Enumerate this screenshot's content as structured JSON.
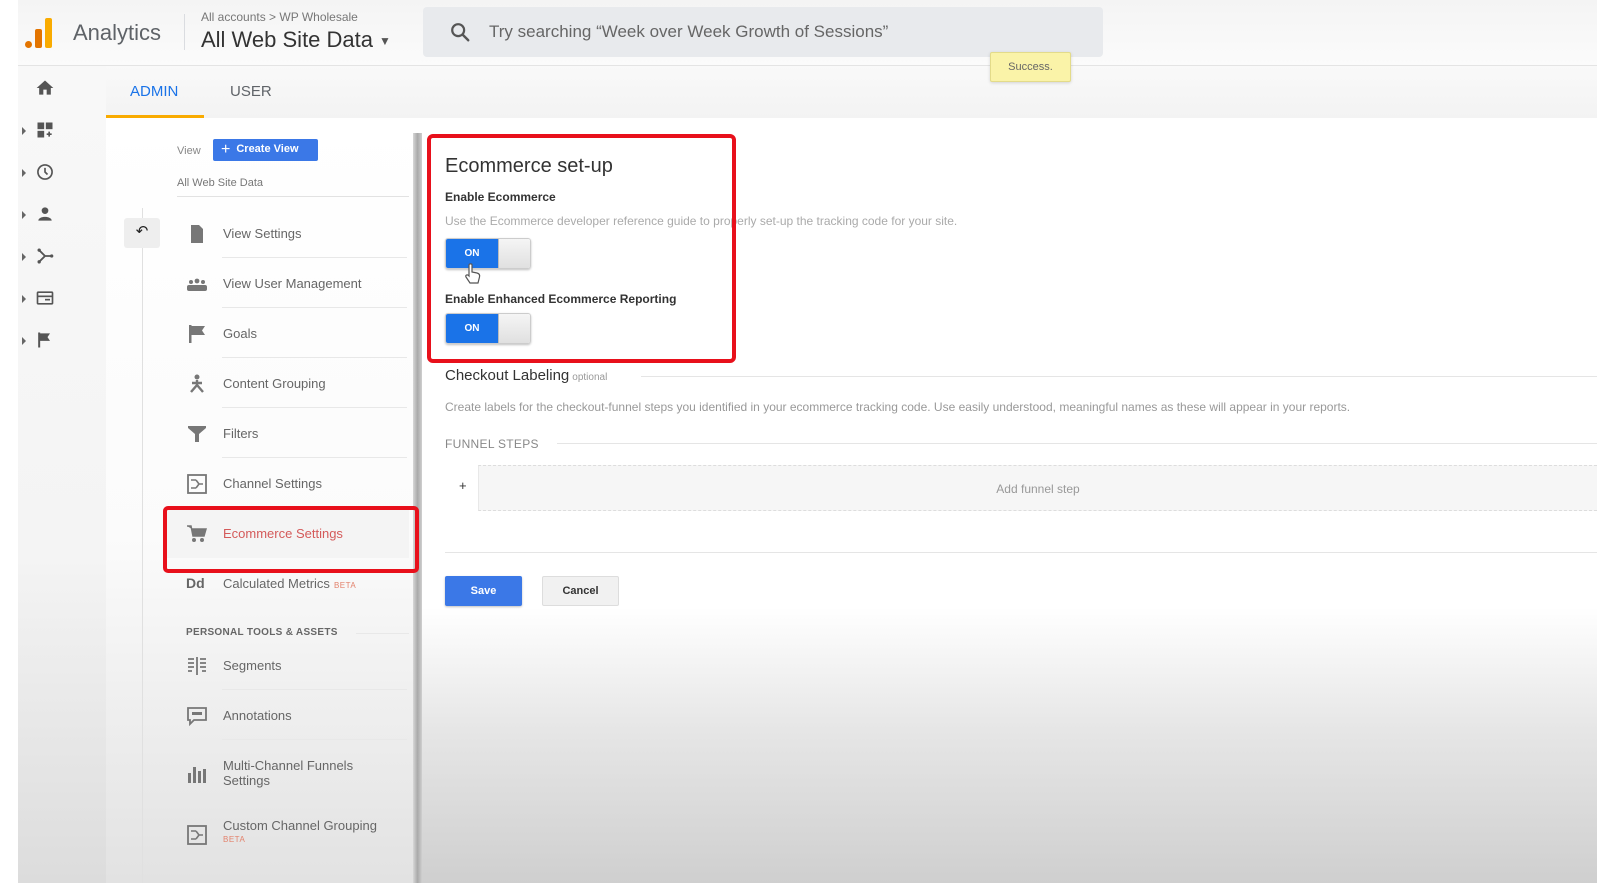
{
  "header": {
    "app_name": "Analytics",
    "breadcrumb": "All accounts > WP Wholesale",
    "property": "All Web Site Data",
    "search_placeholder": "Try searching “Week over Week Growth of Sessions”",
    "toast": "Success."
  },
  "rail": {
    "icons": [
      "home-icon",
      "customization-icon",
      "realtime-icon",
      "audience-icon",
      "acquisition-icon",
      "behavior-icon",
      "conversions-icon"
    ]
  },
  "tabs": [
    {
      "label": "ADMIN",
      "active": true
    },
    {
      "label": "USER",
      "active": false
    }
  ],
  "admin": {
    "view_label": "View",
    "create_view_label": "Create View",
    "view_name": "All Web Site Data",
    "back_label": "↶",
    "menu": [
      {
        "label": "View Settings",
        "icon": "document-icon"
      },
      {
        "label": "View User Management",
        "icon": "users-icon"
      },
      {
        "label": "Goals",
        "icon": "flag-icon"
      },
      {
        "label": "Content Grouping",
        "icon": "content-grouping-icon"
      },
      {
        "label": "Filters",
        "icon": "filter-icon"
      },
      {
        "label": "Channel Settings",
        "icon": "channel-icon"
      },
      {
        "label": "Ecommerce Settings",
        "icon": "cart-icon",
        "active": true
      },
      {
        "label": "Calculated Metrics",
        "icon": "calculated-metrics-icon",
        "badge": "BETA"
      }
    ],
    "section_title": "PERSONAL TOOLS & ASSETS",
    "personal": [
      {
        "label": "Segments",
        "icon": "segments-icon"
      },
      {
        "label": "Annotations",
        "icon": "annotation-icon"
      },
      {
        "label": "Multi-Channel Funnels Settings",
        "icon": "bar-chart-icon"
      },
      {
        "label": "Custom Channel Grouping",
        "icon": "channel-icon",
        "badge": "BETA"
      }
    ]
  },
  "main": {
    "title": "Ecommerce set-up",
    "enable_ecommerce": {
      "label": "Enable Ecommerce",
      "help": "Use the Ecommerce developer reference guide to properly set-up the tracking code for your site.",
      "state": "ON"
    },
    "enhanced": {
      "label": "Enable Enhanced Ecommerce Reporting",
      "state": "ON"
    },
    "checkout": {
      "title": "Checkout Labeling",
      "optional": "optional",
      "help": "Create labels for the checkout-funnel steps you identified in your ecommerce tracking code. Use easily understood, meaningful names as these will appear in your reports."
    },
    "funnel_steps_label": "FUNNEL STEPS",
    "funnel_plus": "+",
    "add_step_label": "Add funnel step",
    "save_label": "Save",
    "cancel_label": "Cancel"
  },
  "colors": {
    "accent_blue": "#1a73e8",
    "button_blue": "#3b78e7",
    "highlight_red": "#e8101b",
    "tab_underline": "#f9ab00",
    "active_item_text": "#d45a5a"
  }
}
